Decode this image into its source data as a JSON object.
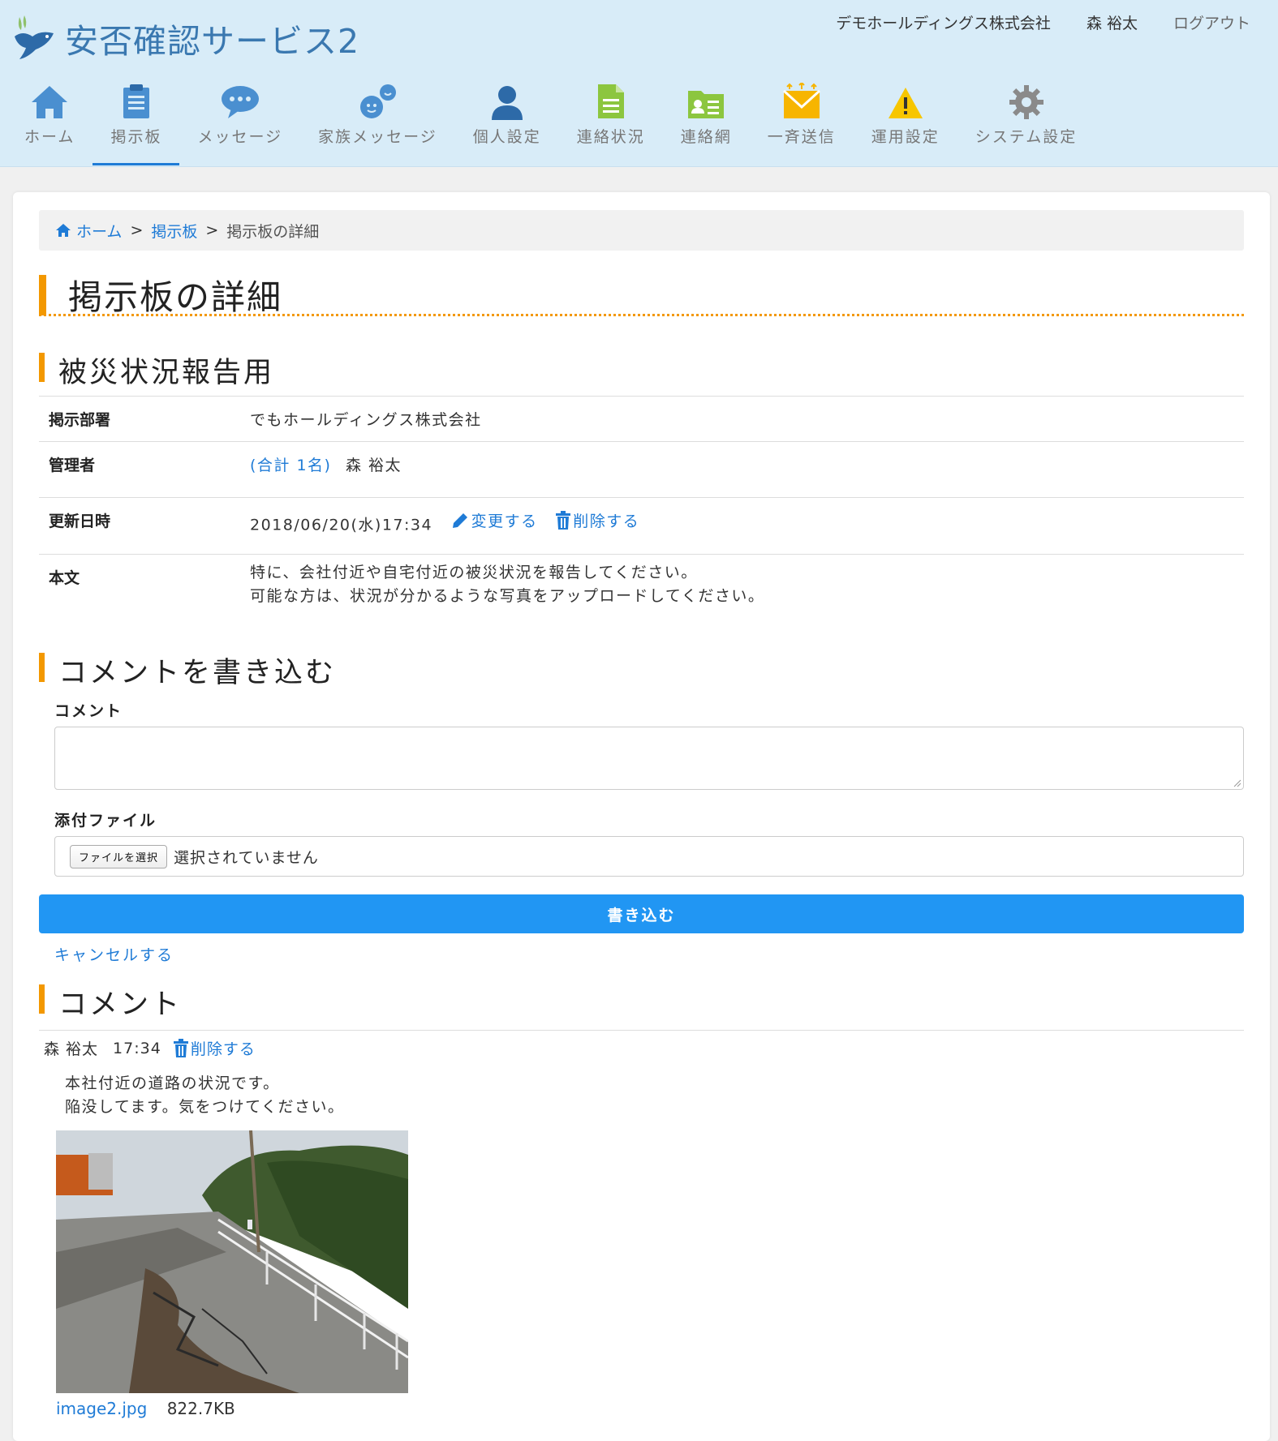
{
  "app": {
    "title": "安否確認サービス2",
    "company": "デモホールディングス株式会社",
    "user": "森 裕太",
    "logout": "ログアウト"
  },
  "nav": [
    {
      "label": "ホーム",
      "icon": "home-icon"
    },
    {
      "label": "掲示板",
      "icon": "clipboard-icon",
      "active": true
    },
    {
      "label": "メッセージ",
      "icon": "speech-bubble-icon"
    },
    {
      "label": "家族メッセージ",
      "icon": "family-message-icon"
    },
    {
      "label": "個人設定",
      "icon": "person-icon"
    },
    {
      "label": "連絡状況",
      "icon": "document-icon"
    },
    {
      "label": "連絡網",
      "icon": "contact-card-icon"
    },
    {
      "label": "一斉送信",
      "icon": "envelope-broadcast-icon"
    },
    {
      "label": "運用設定",
      "icon": "warning-icon"
    },
    {
      "label": "システム設定",
      "icon": "gear-icon"
    }
  ],
  "breadcrumb": {
    "home": "ホーム",
    "board": "掲示板",
    "current": "掲示板の詳細",
    "separator": ">"
  },
  "page_title": "掲示板の詳細",
  "board": {
    "title": "被災状況報告用",
    "rows": {
      "dept_label": "掲示部署",
      "dept_value": "でもホールディングス株式会社",
      "admin_label": "管理者",
      "admin_count": "(合計 1名)",
      "admin_name": "森 裕太",
      "updated_label": "更新日時",
      "updated_value": "2018/06/20(水)17:34",
      "edit_link": "変更する",
      "delete_link": "削除する",
      "body_label": "本文",
      "body_line1": "特に、会社付近や自宅付近の被災状況を報告してください。",
      "body_line2": "可能な方は、状況が分かるような写真をアップロードしてください。"
    }
  },
  "comment_form": {
    "title": "コメントを書き込む",
    "comment_label": "コメント",
    "comment_value": "",
    "attachment_label": "添付ファイル",
    "file_button": "ファイルを選択",
    "file_status": "選択されていません",
    "submit": "書き込む",
    "cancel": "キャンセルする"
  },
  "comments": {
    "title": "コメント",
    "items": [
      {
        "author": "森 裕太",
        "time": "17:34",
        "delete": "削除する",
        "line1": "本社付近の道路の状況です。",
        "line2": "陥没してます。気をつけてください。",
        "file_name": "image2.jpg",
        "file_size": "822.7KB"
      }
    ]
  },
  "colors": {
    "accent": "#f39800",
    "link": "#1f7bd6",
    "primary_button": "#2196f3",
    "header_bg": "#d8ecf8"
  }
}
